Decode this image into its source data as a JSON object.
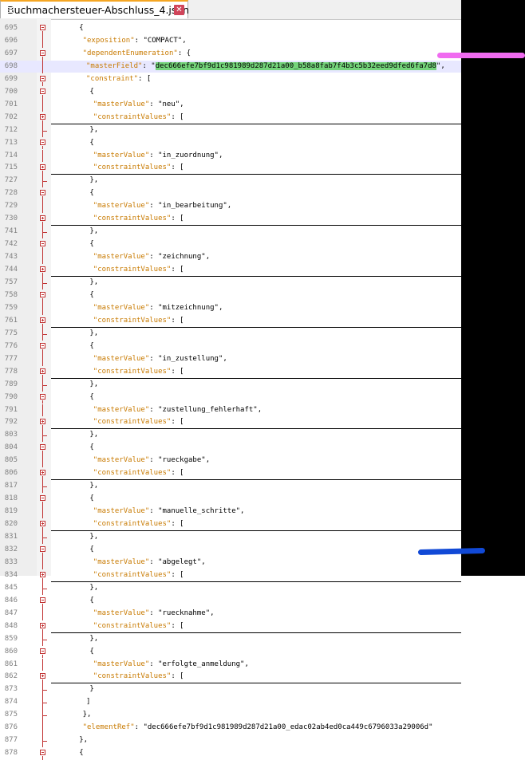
{
  "tab": {
    "title": "Buchmachersteuer-Abschluss_4.json",
    "icon": "json-file-icon",
    "close_icon": "close-icon"
  },
  "colors": {
    "key": "#c87a00",
    "fold_marker": "#c03030",
    "selection": "#74d47a",
    "highlight_line": "#e8e8ff"
  },
  "lines": [
    {
      "num": "695",
      "fold": "minus",
      "indent": 8,
      "parts": [
        {
          "t": "{",
          "c": "p"
        }
      ]
    },
    {
      "num": "696",
      "fold": "",
      "indent": 9,
      "parts": [
        {
          "t": "\"exposition\"",
          "c": "key"
        },
        {
          "t": ": \"COMPACT\",",
          "c": "p"
        }
      ]
    },
    {
      "num": "697",
      "fold": "minus",
      "indent": 9,
      "parts": [
        {
          "t": "\"dependentEnumeration\"",
          "c": "key"
        },
        {
          "t": ": {",
          "c": "p"
        }
      ]
    },
    {
      "num": "698",
      "fold": "",
      "indent": 10,
      "hl": true,
      "parts": [
        {
          "t": "\"masterField\"",
          "c": "key"
        },
        {
          "t": ": \"",
          "c": "p"
        },
        {
          "t": "dec666efe7bf9d1c981989d287d21a00_b58a8fab7f4b3c5b32eed9dfed6fa7d8",
          "c": "sel"
        },
        {
          "t": "\",",
          "c": "p"
        }
      ]
    },
    {
      "num": "699",
      "fold": "minus",
      "indent": 10,
      "parts": [
        {
          "t": "\"constraint\"",
          "c": "key"
        },
        {
          "t": ": [",
          "c": "p"
        }
      ]
    },
    {
      "num": "700",
      "fold": "minus",
      "indent": 11,
      "parts": [
        {
          "t": "{",
          "c": "p"
        }
      ]
    },
    {
      "num": "701",
      "fold": "",
      "indent": 12,
      "parts": [
        {
          "t": "\"masterValue\"",
          "c": "key"
        },
        {
          "t": ": \"neu\",",
          "c": "p"
        }
      ]
    },
    {
      "num": "702",
      "fold": "plus",
      "indent": 12,
      "parts": [
        {
          "t": "\"constraintValues\"",
          "c": "key"
        },
        {
          "t": ": [",
          "c": "p"
        }
      ]
    },
    {
      "num": "712",
      "fold": "",
      "indent": 11,
      "parts": [
        {
          "t": "},",
          "c": "p"
        }
      ]
    },
    {
      "num": "713",
      "fold": "minus",
      "indent": 11,
      "parts": [
        {
          "t": "{",
          "c": "p"
        }
      ]
    },
    {
      "num": "714",
      "fold": "",
      "indent": 12,
      "parts": [
        {
          "t": "\"masterValue\"",
          "c": "key"
        },
        {
          "t": ": \"in_zuordnung\",",
          "c": "p"
        }
      ]
    },
    {
      "num": "715",
      "fold": "plus",
      "indent": 12,
      "parts": [
        {
          "t": "\"constraintValues\"",
          "c": "key"
        },
        {
          "t": ": [",
          "c": "p"
        }
      ]
    },
    {
      "num": "727",
      "fold": "",
      "indent": 11,
      "parts": [
        {
          "t": "},",
          "c": "p"
        }
      ]
    },
    {
      "num": "728",
      "fold": "minus",
      "indent": 11,
      "parts": [
        {
          "t": "{",
          "c": "p"
        }
      ]
    },
    {
      "num": "729",
      "fold": "",
      "indent": 12,
      "parts": [
        {
          "t": "\"masterValue\"",
          "c": "key"
        },
        {
          "t": ": \"in_bearbeitung\",",
          "c": "p"
        }
      ]
    },
    {
      "num": "730",
      "fold": "plus",
      "indent": 12,
      "parts": [
        {
          "t": "\"constraintValues\"",
          "c": "key"
        },
        {
          "t": ": [",
          "c": "p"
        }
      ]
    },
    {
      "num": "741",
      "fold": "",
      "indent": 11,
      "parts": [
        {
          "t": "},",
          "c": "p"
        }
      ]
    },
    {
      "num": "742",
      "fold": "minus",
      "indent": 11,
      "parts": [
        {
          "t": "{",
          "c": "p"
        }
      ]
    },
    {
      "num": "743",
      "fold": "",
      "indent": 12,
      "parts": [
        {
          "t": "\"masterValue\"",
          "c": "key"
        },
        {
          "t": ": \"zeichnung\",",
          "c": "p"
        }
      ]
    },
    {
      "num": "744",
      "fold": "plus",
      "indent": 12,
      "parts": [
        {
          "t": "\"constraintValues\"",
          "c": "key"
        },
        {
          "t": ": [",
          "c": "p"
        }
      ]
    },
    {
      "num": "757",
      "fold": "",
      "indent": 11,
      "parts": [
        {
          "t": "},",
          "c": "p"
        }
      ]
    },
    {
      "num": "758",
      "fold": "minus",
      "indent": 11,
      "parts": [
        {
          "t": "{",
          "c": "p"
        }
      ]
    },
    {
      "num": "759",
      "fold": "",
      "indent": 12,
      "parts": [
        {
          "t": "\"masterValue\"",
          "c": "key"
        },
        {
          "t": ": \"mitzeichnung\",",
          "c": "p"
        }
      ]
    },
    {
      "num": "761",
      "fold": "plus",
      "indent": 12,
      "parts": [
        {
          "t": "\"constraintValues\"",
          "c": "key"
        },
        {
          "t": ": [",
          "c": "p"
        }
      ]
    },
    {
      "num": "775",
      "fold": "",
      "indent": 11,
      "parts": [
        {
          "t": "},",
          "c": "p"
        }
      ]
    },
    {
      "num": "776",
      "fold": "minus",
      "indent": 11,
      "parts": [
        {
          "t": "{",
          "c": "p"
        }
      ]
    },
    {
      "num": "777",
      "fold": "",
      "indent": 12,
      "parts": [
        {
          "t": "\"masterValue\"",
          "c": "key"
        },
        {
          "t": ": \"in_zustellung\",",
          "c": "p"
        }
      ]
    },
    {
      "num": "778",
      "fold": "plus",
      "indent": 12,
      "parts": [
        {
          "t": "\"constraintValues\"",
          "c": "key"
        },
        {
          "t": ": [",
          "c": "p"
        }
      ]
    },
    {
      "num": "789",
      "fold": "",
      "indent": 11,
      "parts": [
        {
          "t": "},",
          "c": "p"
        }
      ]
    },
    {
      "num": "790",
      "fold": "minus",
      "indent": 11,
      "parts": [
        {
          "t": "{",
          "c": "p"
        }
      ]
    },
    {
      "num": "791",
      "fold": "",
      "indent": 12,
      "parts": [
        {
          "t": "\"masterValue\"",
          "c": "key"
        },
        {
          "t": ": \"zustellung_fehlerhaft\",",
          "c": "p"
        }
      ]
    },
    {
      "num": "792",
      "fold": "plus",
      "indent": 12,
      "parts": [
        {
          "t": "\"constraintValues\"",
          "c": "key"
        },
        {
          "t": ": [",
          "c": "p"
        }
      ]
    },
    {
      "num": "803",
      "fold": "",
      "indent": 11,
      "parts": [
        {
          "t": "},",
          "c": "p"
        }
      ]
    },
    {
      "num": "804",
      "fold": "minus",
      "indent": 11,
      "parts": [
        {
          "t": "{",
          "c": "p"
        }
      ]
    },
    {
      "num": "805",
      "fold": "",
      "indent": 12,
      "parts": [
        {
          "t": "\"masterValue\"",
          "c": "key"
        },
        {
          "t": ": \"rueckgabe\",",
          "c": "p"
        }
      ]
    },
    {
      "num": "806",
      "fold": "plus",
      "indent": 12,
      "parts": [
        {
          "t": "\"constraintValues\"",
          "c": "key"
        },
        {
          "t": ": [",
          "c": "p"
        }
      ]
    },
    {
      "num": "817",
      "fold": "",
      "indent": 11,
      "parts": [
        {
          "t": "},",
          "c": "p"
        }
      ]
    },
    {
      "num": "818",
      "fold": "minus",
      "indent": 11,
      "parts": [
        {
          "t": "{",
          "c": "p"
        }
      ]
    },
    {
      "num": "819",
      "fold": "",
      "indent": 12,
      "parts": [
        {
          "t": "\"masterValue\"",
          "c": "key"
        },
        {
          "t": ": \"manuelle_schritte\",",
          "c": "p"
        }
      ]
    },
    {
      "num": "820",
      "fold": "plus",
      "indent": 12,
      "parts": [
        {
          "t": "\"constraintValues\"",
          "c": "key"
        },
        {
          "t": ": [",
          "c": "p"
        }
      ]
    },
    {
      "num": "831",
      "fold": "",
      "indent": 11,
      "parts": [
        {
          "t": "},",
          "c": "p"
        }
      ]
    },
    {
      "num": "832",
      "fold": "minus",
      "indent": 11,
      "parts": [
        {
          "t": "{",
          "c": "p"
        }
      ]
    },
    {
      "num": "833",
      "fold": "",
      "indent": 12,
      "parts": [
        {
          "t": "\"masterValue\"",
          "c": "key"
        },
        {
          "t": ": \"abgelegt\",",
          "c": "p"
        }
      ]
    },
    {
      "num": "834",
      "fold": "plus",
      "indent": 12,
      "parts": [
        {
          "t": "\"constraintValues\"",
          "c": "key"
        },
        {
          "t": ": [",
          "c": "p"
        }
      ]
    },
    {
      "num": "845",
      "fold": "",
      "indent": 11,
      "parts": [
        {
          "t": "},",
          "c": "p"
        }
      ]
    },
    {
      "num": "846",
      "fold": "minus",
      "indent": 11,
      "parts": [
        {
          "t": "{",
          "c": "p"
        }
      ]
    },
    {
      "num": "847",
      "fold": "",
      "indent": 12,
      "parts": [
        {
          "t": "\"masterValue\"",
          "c": "key"
        },
        {
          "t": ": \"ruecknahme\",",
          "c": "p"
        }
      ]
    },
    {
      "num": "848",
      "fold": "plus",
      "indent": 12,
      "parts": [
        {
          "t": "\"constraintValues\"",
          "c": "key"
        },
        {
          "t": ": [",
          "c": "p"
        }
      ]
    },
    {
      "num": "859",
      "fold": "",
      "indent": 11,
      "parts": [
        {
          "t": "},",
          "c": "p"
        }
      ]
    },
    {
      "num": "860",
      "fold": "minus",
      "indent": 11,
      "parts": [
        {
          "t": "{",
          "c": "p"
        }
      ]
    },
    {
      "num": "861",
      "fold": "",
      "indent": 12,
      "parts": [
        {
          "t": "\"masterValue\"",
          "c": "key"
        },
        {
          "t": ": \"erfolgte_anmeldung\",",
          "c": "p"
        }
      ]
    },
    {
      "num": "862",
      "fold": "plus",
      "indent": 12,
      "parts": [
        {
          "t": "\"constraintValues\"",
          "c": "key"
        },
        {
          "t": ": [",
          "c": "p"
        }
      ]
    },
    {
      "num": "873",
      "fold": "",
      "indent": 11,
      "parts": [
        {
          "t": "}",
          "c": "p"
        }
      ]
    },
    {
      "num": "874",
      "fold": "",
      "indent": 10,
      "parts": [
        {
          "t": "]",
          "c": "p"
        }
      ]
    },
    {
      "num": "875",
      "fold": "",
      "indent": 9,
      "parts": [
        {
          "t": "},",
          "c": "p"
        }
      ]
    },
    {
      "num": "876",
      "fold": "",
      "indent": 9,
      "parts": [
        {
          "t": "\"elementRef\"",
          "c": "key"
        },
        {
          "t": ": \"dec666efe7bf9d1c981989d287d21a00_edac02ab4ed0ca449c6796033a29006d\"",
          "c": "p"
        }
      ]
    },
    {
      "num": "877",
      "fold": "",
      "indent": 8,
      "parts": [
        {
          "t": "},",
          "c": "p"
        }
      ]
    },
    {
      "num": "878",
      "fold": "minus",
      "indent": 8,
      "parts": [
        {
          "t": "{",
          "c": "p"
        }
      ]
    }
  ]
}
